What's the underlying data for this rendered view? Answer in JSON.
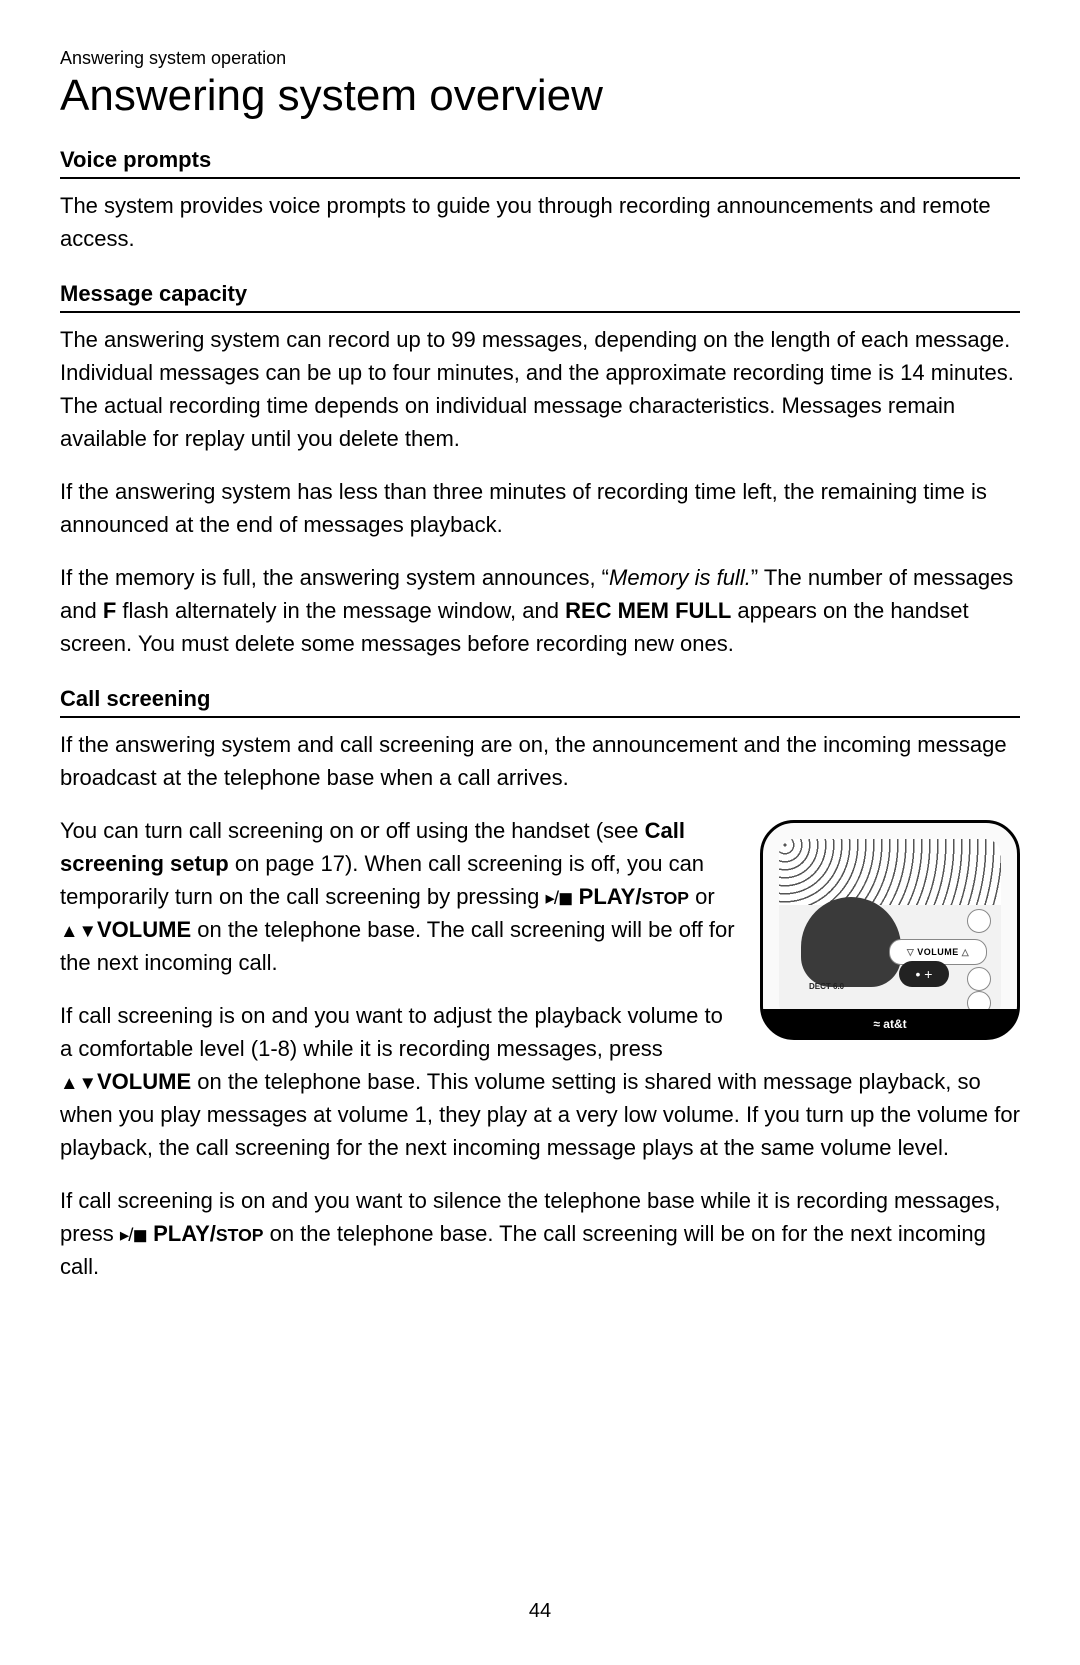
{
  "chapter": "Answering system operation",
  "title": "Answering system overview",
  "page_number": "44",
  "sections": {
    "voice": {
      "heading": "Voice prompts",
      "p1": "The system provides voice prompts to guide you through recording announcements and remote access."
    },
    "capacity": {
      "heading": "Message capacity",
      "p1": "The answering system can record up to 99 messages, depending on the length of each message. Individual messages can be up to four minutes, and the approximate recording time is 14 minutes. The actual recording time depends on individual message characteristics. Messages remain available for replay until you delete them.",
      "p2": "If the answering system has less than three minutes of recording time left, the remaining time is announced at the end of messages playback.",
      "p3a": "If the memory is full, the answering system announces, “",
      "p3_em": "Memory is full.",
      "p3b": "” The number of messages and ",
      "p3_F": "F",
      "p3c": " flash alternately in the message window, and ",
      "p3_rec": "REC MEM FULL",
      "p3d": " appears on the handset screen. You must delete some messages before recording new ones."
    },
    "screening": {
      "heading": "Call screening",
      "p1": "If the answering system and call screening are on, the announcement and the incoming message broadcast at the telephone base when a call arrives.",
      "p2a": "You can turn call screening on or off using the handset (see ",
      "p2_ref": "Call screening setup",
      "p2b": " on page 17). When call screening is off, you can temporarily turn on the call screening by pressing ",
      "p2_play": " PLAY/",
      "p2_stop": "STOP",
      "p2c": " or ",
      "p2_vol": "VOLUME",
      "p2d": " on the telephone base. The call screening will be off for the next incoming call.",
      "p3a": "If call screening is on and you want to adjust the playback volume to a comfortable level (1-8) while it is recording messages, press ",
      "p3_vol": "VOLUME",
      "p3b": " on the telephone base. This volume setting is shared with message playback, so when you play messages at volume 1, they play at a very low volume. If you turn up the volume for playback, the call screening for the next incoming message plays at the same volume level.",
      "p4a": "If call screening is on and you want to silence the telephone base while it is recording messages, press ",
      "p4_play": " PLAY/",
      "p4_stop": "STOP",
      "p4b": " on the telephone base. The call screening will be on for the next incoming call."
    }
  },
  "illustration": {
    "volume_label": "VOLUME",
    "dect_label": "DECT 6.0",
    "brand_label": "≈ at&t",
    "plus_label": "• +"
  }
}
